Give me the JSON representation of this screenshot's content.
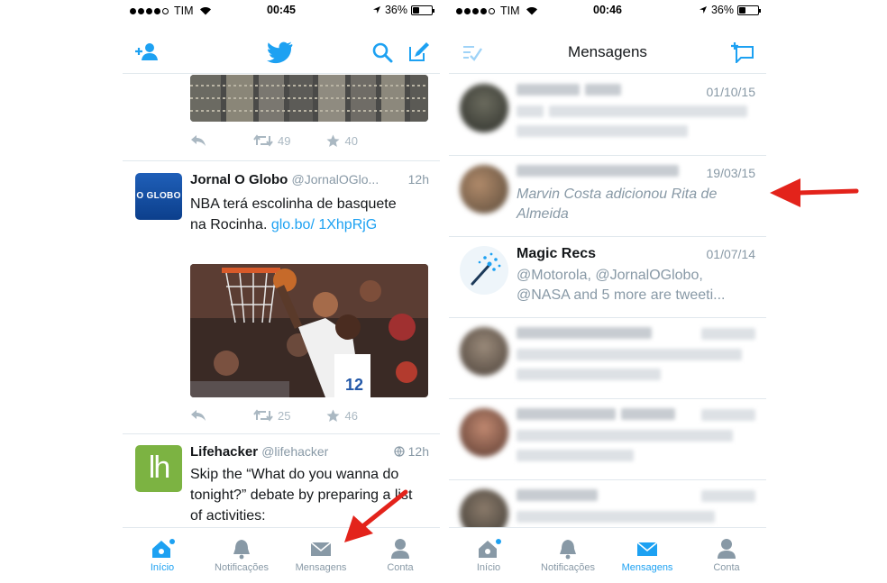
{
  "left": {
    "status": {
      "carrier": "TIM",
      "time": "00:45",
      "battery": "36%"
    },
    "tweets": [
      {
        "retweets": "49",
        "likes": "40"
      },
      {
        "name": "Jornal O Globo",
        "handle": "@JornalOGlo...",
        "time": "12h",
        "avatar_text": "O GLOBO",
        "text_plain": "NBA terá escolinha de basquete na Rocinha. ",
        "link": "glo.bo/ 1XhpRjG",
        "retweets": "25",
        "likes": "46"
      },
      {
        "name": "Lifehacker",
        "handle": "@lifehacker",
        "time": "12h",
        "avatar_text": "lh",
        "text": "Skip the “What do you wanna do tonight?” debate by preparing a list of activities:"
      }
    ],
    "tabs": [
      {
        "label": "Início",
        "icon": "home-icon",
        "active": true
      },
      {
        "label": "Notificações",
        "icon": "bell-icon",
        "active": false
      },
      {
        "label": "Mensagens",
        "icon": "envelope-icon",
        "active": false
      },
      {
        "label": "Conta",
        "icon": "person-icon",
        "active": false
      }
    ]
  },
  "right": {
    "status": {
      "carrier": "TIM",
      "time": "00:46",
      "battery": "36%"
    },
    "title": "Mensagens",
    "messages": [
      {
        "date": "01/10/15",
        "blurred": true
      },
      {
        "date": "19/03/15",
        "preview": "Marvin Costa adicionou Rita de Almeida",
        "blurred_name": true
      },
      {
        "name": "Magic Recs",
        "date": "01/07/14",
        "preview": "@Motorola, @JornalOGlobo, @NASA and 5 more are tweeti..."
      },
      {
        "date": "",
        "blurred": true
      },
      {
        "date": "",
        "blurred": true
      },
      {
        "date": "",
        "blurred": true
      }
    ],
    "tabs": [
      {
        "label": "Início",
        "icon": "home-icon",
        "active": false
      },
      {
        "label": "Notificações",
        "icon": "bell-icon",
        "active": false
      },
      {
        "label": "Mensagens",
        "icon": "envelope-icon",
        "active": true
      },
      {
        "label": "Conta",
        "icon": "person-icon",
        "active": false
      }
    ]
  },
  "colors": {
    "accent": "#1da1f2",
    "muted": "#8899a6",
    "arrow": "#e3231b"
  }
}
